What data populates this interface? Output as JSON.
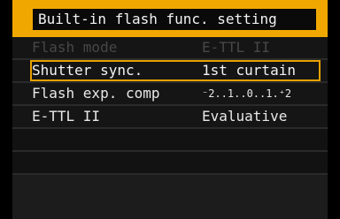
{
  "title": "Built-in flash func. setting",
  "colors": {
    "accent": "#f0a800",
    "background": "#151515",
    "disabled_text": "#474747",
    "text": "#e8e8e8"
  },
  "menu": {
    "items": [
      {
        "label": "Flash mode",
        "value": "E-TTL II",
        "state": "disabled"
      },
      {
        "label": "Shutter sync.",
        "value": "1st curtain",
        "state": "selected"
      },
      {
        "label": "Flash exp. comp",
        "value": "⁻2..1..0..1.⁺2",
        "state": "normal"
      },
      {
        "label": "E-TTL II",
        "value": "Evaluative",
        "state": "normal"
      }
    ]
  }
}
